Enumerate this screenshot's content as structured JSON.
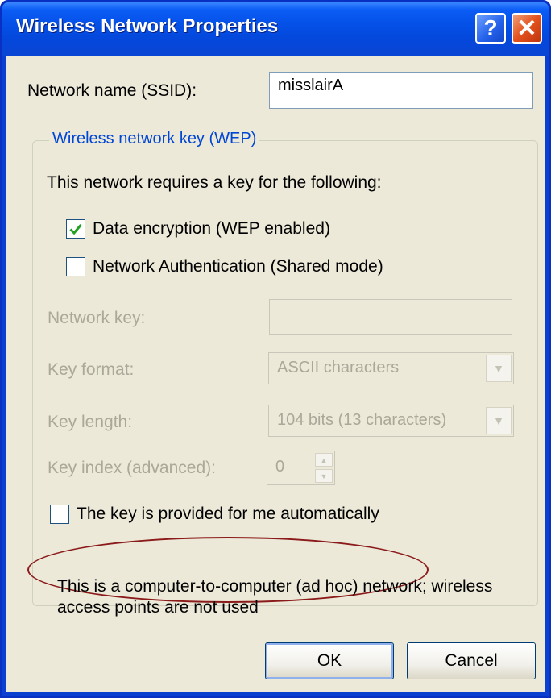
{
  "window": {
    "title": "Wireless Network Properties",
    "help_glyph": "?",
    "close_glyph": "✕"
  },
  "ssid": {
    "label": "Network name (SSID):",
    "value": "misslairA"
  },
  "wep_group": {
    "legend": "Wireless network key (WEP)",
    "intro": "This network requires a key for the following:",
    "data_encryption": {
      "label": "Data encryption (WEP enabled)",
      "checked": true
    },
    "network_auth": {
      "label": "Network Authentication (Shared mode)",
      "checked": false
    },
    "network_key": {
      "label": "Network key:",
      "value": ""
    },
    "key_format": {
      "label": "Key format:",
      "value": "ASCII characters"
    },
    "key_length": {
      "label": "Key length:",
      "value": "104 bits (13 characters)"
    },
    "key_index": {
      "label": "Key index (advanced):",
      "value": "0"
    },
    "auto_key": {
      "label": "The key is provided for me automatically",
      "checked": false
    }
  },
  "adhoc": {
    "line1": "This is a computer-to-computer (ad hoc) network; wireless",
    "line2": "access points are not used",
    "checked": false
  },
  "buttons": {
    "ok": "OK",
    "cancel": "Cancel"
  },
  "colors": {
    "titlebar": "#0551e8",
    "face": "#ece9d8",
    "legend": "#0046d5",
    "disabled_text": "#aca899",
    "highlight_ellipse": "#8b1a1a",
    "check_mark": "#21a121"
  }
}
